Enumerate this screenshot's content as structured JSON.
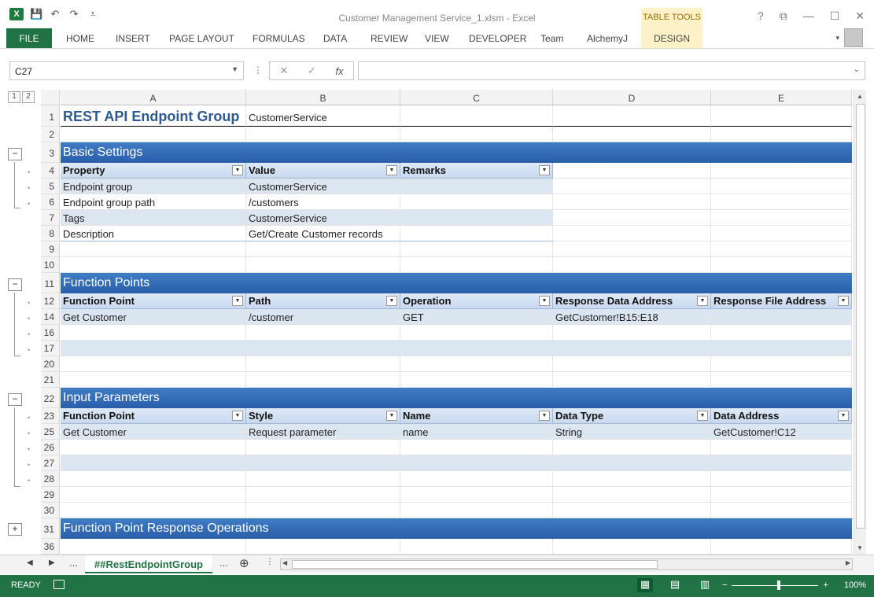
{
  "window": {
    "title": "Customer Management Service_1.xlsm - Excel",
    "table_tools": "TABLE TOOLS",
    "help": "?",
    "restore": "⧉",
    "minimize": "—",
    "maximize": "☐",
    "close": "✕"
  },
  "qat": {
    "logo": "X",
    "save": "💾",
    "undo": "↶",
    "redo": "↷",
    "customize": "⩡"
  },
  "ribbon": {
    "file": "FILE",
    "tabs": [
      "HOME",
      "INSERT",
      "PAGE LAYOUT",
      "FORMULAS",
      "DATA",
      "REVIEW",
      "VIEW",
      "DEVELOPER",
      "Team",
      "AlchemyJ"
    ],
    "design": "DESIGN"
  },
  "formula_bar": {
    "name_box": "C27",
    "cancel": "✕",
    "enter": "✓",
    "fx": "fx",
    "value": ""
  },
  "grid": {
    "outline_levels": [
      "1",
      "2"
    ],
    "columns": [
      "A",
      "B",
      "C",
      "D",
      "E"
    ],
    "rows": {
      "r1": {
        "num": "1",
        "a": "REST API Endpoint Group",
        "b": "CustomerService"
      },
      "r2": {
        "num": "2"
      },
      "r3": {
        "num": "3",
        "section": "Basic Settings"
      },
      "r4": {
        "num": "4",
        "a": "Property",
        "b": "Value",
        "c": "Remarks"
      },
      "r5": {
        "num": "5",
        "a": "Endpoint group",
        "b": "CustomerService"
      },
      "r6": {
        "num": "6",
        "a": "Endpoint group path",
        "b": "/customers"
      },
      "r7": {
        "num": "7",
        "a": "Tags",
        "b": "CustomerService"
      },
      "r8": {
        "num": "8",
        "a": "Description",
        "b": "Get/Create Customer records"
      },
      "r9": {
        "num": "9"
      },
      "r10": {
        "num": "10"
      },
      "r11": {
        "num": "11",
        "section": "Function Points"
      },
      "r12": {
        "num": "12",
        "a": "Function Point",
        "b": "Path",
        "c": "Operation",
        "d": "Response Data Address",
        "e": "Response File Address"
      },
      "r14": {
        "num": "14",
        "a": "Get Customer",
        "b": "/customer",
        "c": "GET",
        "d": "GetCustomer!B15:E18"
      },
      "r16": {
        "num": "16"
      },
      "r17": {
        "num": "17"
      },
      "r20": {
        "num": "20"
      },
      "r21": {
        "num": "21"
      },
      "r22": {
        "num": "22",
        "section": "Input Parameters"
      },
      "r23": {
        "num": "23",
        "a": "Function Point",
        "b": "Style",
        "c": "Name",
        "d": "Data Type",
        "e": "Data Address"
      },
      "r25": {
        "num": "25",
        "a": "Get Customer",
        "b": "Request parameter",
        "c": "name",
        "d": "String",
        "e": "GetCustomer!C12"
      },
      "r26": {
        "num": "26"
      },
      "r27": {
        "num": "27"
      },
      "r28": {
        "num": "28"
      },
      "r29": {
        "num": "29"
      },
      "r30": {
        "num": "30"
      },
      "r31": {
        "num": "31",
        "section": "Function Point Response Operations"
      },
      "r36": {
        "num": "36"
      }
    }
  },
  "sheets": {
    "ellipsis_left": "...",
    "active": "##RestEndpointGroup",
    "ellipsis_right": "...",
    "add": "⊕"
  },
  "status": {
    "ready": "READY",
    "zoom": "100%",
    "minus": "−",
    "plus": "+"
  },
  "colors": {
    "excel_green": "#217346",
    "section_blue": "#2a5fa8",
    "header_blue": "#c9d9ef",
    "band_blue": "#dce6f1"
  }
}
